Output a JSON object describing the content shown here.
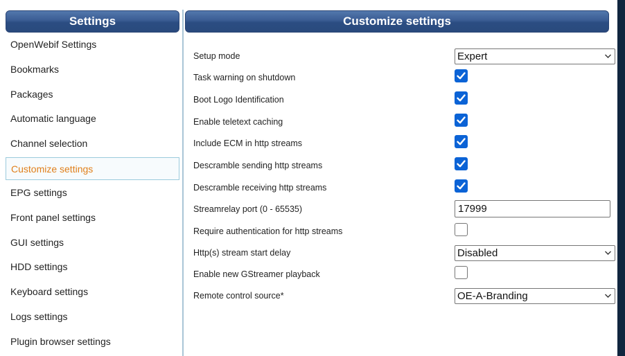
{
  "left_panel": {
    "title": "Settings",
    "items": [
      {
        "label": "OpenWebif Settings",
        "active": false
      },
      {
        "label": "Bookmarks",
        "active": false
      },
      {
        "label": "Packages",
        "active": false
      },
      {
        "label": "Automatic language",
        "active": false
      },
      {
        "label": "Channel selection",
        "active": false
      },
      {
        "label": "Customize settings",
        "active": true
      },
      {
        "label": "EPG settings",
        "active": false
      },
      {
        "label": "Front panel settings",
        "active": false
      },
      {
        "label": "GUI settings",
        "active": false
      },
      {
        "label": "HDD settings",
        "active": false
      },
      {
        "label": "Keyboard settings",
        "active": false
      },
      {
        "label": "Logs settings",
        "active": false
      },
      {
        "label": "Plugin browser settings",
        "active": false
      }
    ]
  },
  "right_panel": {
    "title": "Customize settings",
    "settings": [
      {
        "label": "Setup mode",
        "type": "select",
        "value": "Expert"
      },
      {
        "label": "Task warning on shutdown",
        "type": "checkbox",
        "checked": true
      },
      {
        "label": "Boot Logo Identification",
        "type": "checkbox",
        "checked": true
      },
      {
        "label": "Enable teletext caching",
        "type": "checkbox",
        "checked": true
      },
      {
        "label": "Include ECM in http streams",
        "type": "checkbox",
        "checked": true
      },
      {
        "label": "Descramble sending http streams",
        "type": "checkbox",
        "checked": true
      },
      {
        "label": "Descramble receiving http streams",
        "type": "checkbox",
        "checked": true
      },
      {
        "label": "Streamrelay port (0 - 65535)",
        "type": "text",
        "value": "17999"
      },
      {
        "label": "Require authentication for http streams",
        "type": "checkbox",
        "checked": false
      },
      {
        "label": "Http(s) stream start delay",
        "type": "select",
        "value": "Disabled"
      },
      {
        "label": "Enable new GStreamer playback",
        "type": "checkbox",
        "checked": false
      },
      {
        "label": "Remote control source*",
        "type": "select",
        "value": "OE-A-Branding"
      }
    ]
  },
  "colors": {
    "header_gradient_top": "#5378ad",
    "header_gradient_bottom": "#2a4a7d",
    "active_item_text": "#e07f1a",
    "checkbox_checked": "#0b63d6",
    "divider": "#a9c5d6"
  }
}
